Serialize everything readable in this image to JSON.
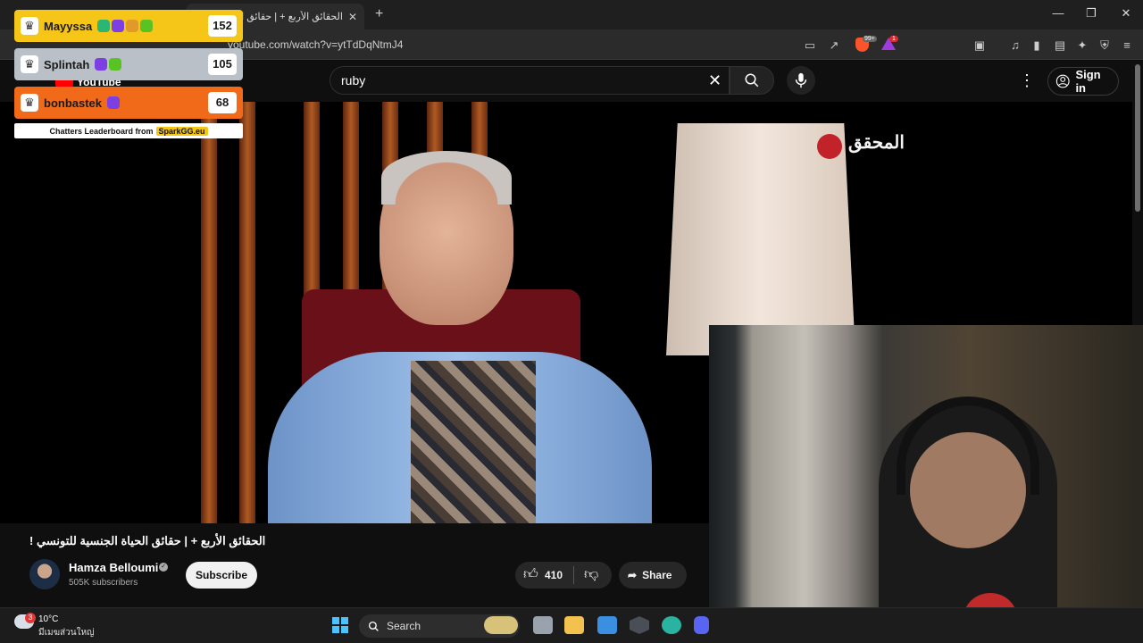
{
  "browser": {
    "tab_title": "الحقائق الأربع + | حقائق الحياة الجنسية للتونسي !",
    "tab_close": "✕",
    "new_tab": "+",
    "url": "youtube.com/watch?v=ytTdDqNtmJ4",
    "brave_badge": "99+",
    "rewards_badge": "1",
    "window_controls": {
      "minimize": "—",
      "maximize": "❐",
      "close": "✕"
    }
  },
  "youtube": {
    "logo_text": "YouTube",
    "search_value": "ruby",
    "search_clear": "✕",
    "more": "⋮",
    "sign_in": "Sign in"
  },
  "video": {
    "watermark": "المحقق"
  },
  "meta": {
    "title": "الحقائق الأربع + | حقائق الحياة الجنسية للتونسي !",
    "channel": "Hamza Belloumi",
    "verified": "✓",
    "subscribers": "505K subscribers",
    "subscribe_label": "Subscribe",
    "likes": "410",
    "share_label": "Share"
  },
  "leaderboard": {
    "rows": [
      {
        "name": "Mayyssa",
        "score": "152",
        "color": "#f5c518"
      },
      {
        "name": "Splintah",
        "score": "105",
        "color": "#b9c0c8"
      },
      {
        "name": "bonbastek",
        "score": "68",
        "color": "#f06a1a"
      }
    ],
    "footer_text": "Chatters Leaderboard from",
    "footer_brand": "SparkGG.eu",
    "crown": "♛"
  },
  "taskbar": {
    "weather_temp": "10°C",
    "weather_desc": "มีเมฆส่วนใหญ่",
    "weather_badge": "3",
    "search_label": "Search"
  }
}
